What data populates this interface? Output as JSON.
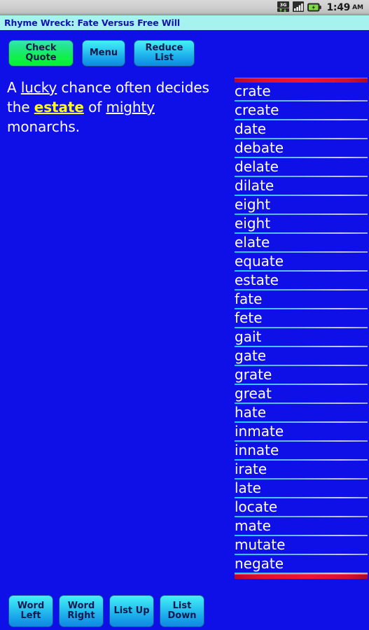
{
  "statusbar": {
    "network_icon": "3g-data-icon",
    "signal_icon": "signal-bars-icon",
    "battery_icon": "battery-charging-icon",
    "time": "1:49",
    "ampm": "AM"
  },
  "titlebar": {
    "title": "Rhyme Wreck: Fate Versus Free Will",
    "background": "#a6f2ef",
    "text_color": "#1212b0"
  },
  "toolbar": {
    "check_quote_label": "Check Quote",
    "menu_label": "Menu",
    "reduce_list_label": "Reduce List"
  },
  "quote": {
    "segments": [
      {
        "text": "A ",
        "style": "plain"
      },
      {
        "text": "lucky",
        "style": "underline"
      },
      {
        "text": " chance often decides the ",
        "style": "plain"
      },
      {
        "text": "estate",
        "style": "highlight"
      },
      {
        "text": " of ",
        "style": "plain"
      },
      {
        "text": "mighty",
        "style": "underline"
      },
      {
        "text": " monarchs.",
        "style": "plain"
      }
    ],
    "full_text": "A lucky chance often decides the estate of mighty monarchs.",
    "text_color": "#ffffff",
    "highlight_color": "#ffff00"
  },
  "wordlist": {
    "top_marker_color": "#e0102c",
    "bottom_marker_color": "#e0102c",
    "words": [
      "crate",
      "create",
      "date",
      "debate",
      "delate",
      "dilate",
      "eight",
      "eight",
      "elate",
      "equate",
      "estate",
      "fate",
      "fete",
      "gait",
      "gate",
      "grate",
      "great",
      "hate",
      "inmate",
      "innate",
      "irate",
      "late",
      "locate",
      "mate",
      "mutate",
      "negate"
    ]
  },
  "bottombar": {
    "word_left_line1": "Word",
    "word_left_line2": "Left",
    "word_right_line1": "Word",
    "word_right_line2": "Right",
    "list_up_label": "List Up",
    "list_down_line1": "List",
    "list_down_line2": "Down"
  },
  "colors": {
    "app_background": "#0f0fe8",
    "button_green": "#11ef4c",
    "button_cyan": "#1aa8ea",
    "separator": "#6fb8f5"
  }
}
